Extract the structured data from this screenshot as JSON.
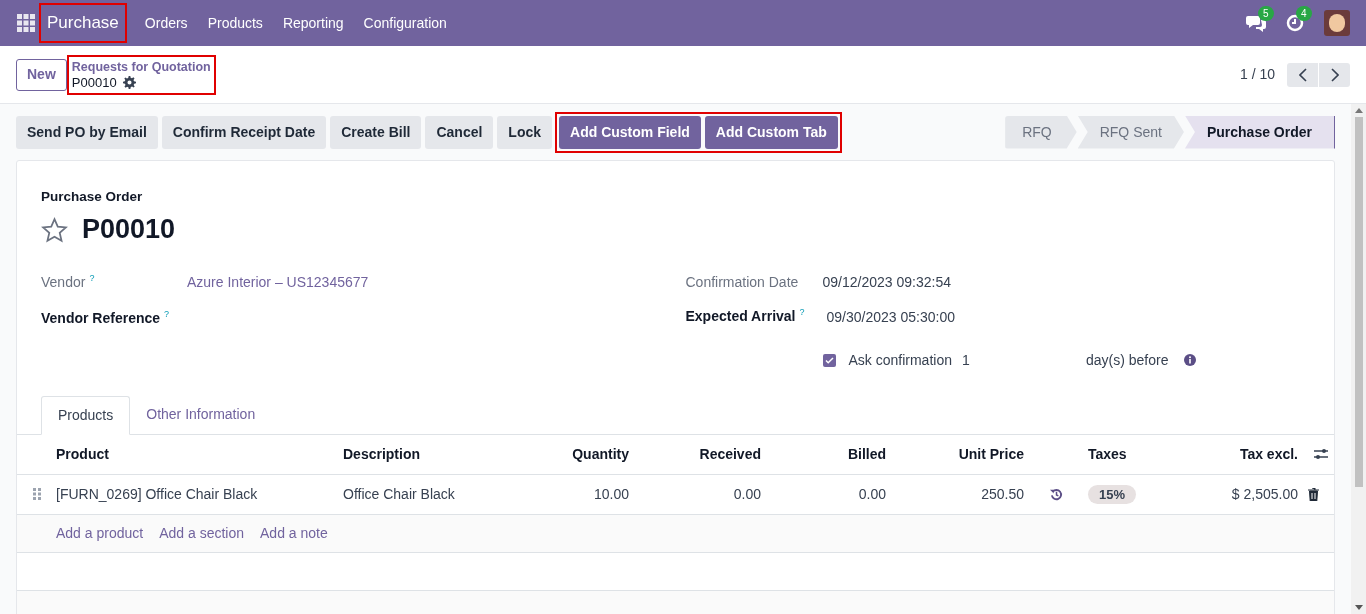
{
  "navbar": {
    "app_name": "Purchase",
    "app_highlighted": true,
    "menu": [
      "Orders",
      "Products",
      "Reporting",
      "Configuration"
    ],
    "messages_count": "5",
    "activities_count": "4"
  },
  "control_panel": {
    "new_button": "New",
    "breadcrumb": "Requests for Quotation",
    "record": "P00010",
    "highlighted": true,
    "pager": "1 / 10"
  },
  "action_buttons": [
    {
      "label": "Send PO by Email",
      "kind": "secondary"
    },
    {
      "label": "Confirm Receipt Date",
      "kind": "secondary"
    },
    {
      "label": "Create Bill",
      "kind": "secondary"
    },
    {
      "label": "Cancel",
      "kind": "secondary"
    },
    {
      "label": "Lock",
      "kind": "secondary"
    },
    {
      "label": "Add Custom Field",
      "kind": "primary"
    },
    {
      "label": "Add Custom Tab",
      "kind": "primary"
    }
  ],
  "status_bar": [
    {
      "label": "RFQ",
      "selected": false
    },
    {
      "label": "RFQ Sent",
      "selected": false
    },
    {
      "label": "Purchase Order",
      "selected": true
    }
  ],
  "form": {
    "title_label": "Purchase Order",
    "title": "P00010",
    "favorite": false,
    "vendor": {
      "label": "Vendor",
      "help": "?",
      "value": "Azure Interior – US12345677"
    },
    "vendor_reference": {
      "label": "Vendor Reference",
      "help": "?"
    },
    "confirmation_date": {
      "label": "Confirmation Date",
      "value": "09/12/2023 09:32:54"
    },
    "expected_arrival": {
      "label": "Expected Arrival",
      "help": "?",
      "value": "09/30/2023 05:30:00"
    },
    "ask_confirmation": {
      "label": "Ask confirmation",
      "checked": true,
      "days": "1",
      "suffix": "day(s) before"
    }
  },
  "tabs": [
    {
      "label": "Products",
      "selected": true
    },
    {
      "label": "Other Information",
      "selected": false
    }
  ],
  "table": {
    "columns": [
      "Product",
      "Description",
      "Quantity",
      "Received",
      "Billed",
      "Unit Price",
      "Taxes",
      "Tax excl."
    ],
    "rows": [
      {
        "product": "[FURN_0269] Office Chair Black",
        "description": "Office Chair Black",
        "quantity": "10.00",
        "received": "0.00",
        "billed": "0.00",
        "unit_price": "250.50",
        "taxes": "15%",
        "tax_excl": "$ 2,505.00"
      }
    ],
    "add_links": [
      "Add a product",
      "Add a section",
      "Add a note"
    ]
  }
}
